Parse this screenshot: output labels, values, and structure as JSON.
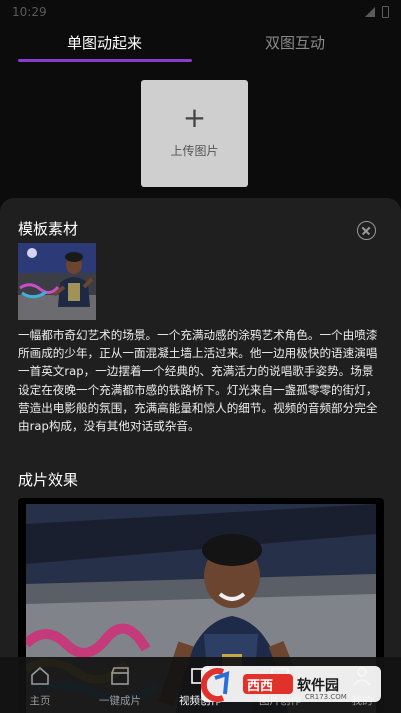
{
  "status_bar": {
    "time": "10:29"
  },
  "tabs": [
    {
      "label": "单图动起来",
      "active": true
    },
    {
      "label": "双图互动",
      "active": false
    }
  ],
  "upload": {
    "plus": "+",
    "label": "上传图片"
  },
  "sheet": {
    "title": "模板素材",
    "description": "一幅都市奇幻艺术的场景。一个充满动感的涂鸦艺术角色。一个由喷漆所画成的少年，正从一面混凝土墙上活过来。他一边用极快的语速演唱一首英文rap，一边摆着一个经典的、充满活力的说唱歌手姿势。场景设定在夜晚一个充满都市感的铁路桥下。灯光来自一盏孤零零的街灯，营造出电影般的氛围，充满高能量和惊人的细节。视频的音频部分完全由rap构成，没有其他对话或杂音。",
    "result_title": "成片效果"
  },
  "nav": [
    {
      "label": "主页",
      "icon": "home-icon"
    },
    {
      "label": "一键成片",
      "icon": "clapperboard-icon"
    },
    {
      "label": "视频创作",
      "icon": "video-create-icon",
      "active": true
    },
    {
      "label": "图片创作",
      "icon": "image-create-icon"
    },
    {
      "label": "我的",
      "icon": "profile-icon"
    }
  ],
  "watermark": {
    "brand": "西西软件园",
    "domain": "CR173.COM"
  },
  "colors": {
    "accent": "#8c3bd1",
    "sheet_bg": "#1f1f1f",
    "page_bg": "#0c0c0c",
    "watermark": "#e0322b"
  }
}
